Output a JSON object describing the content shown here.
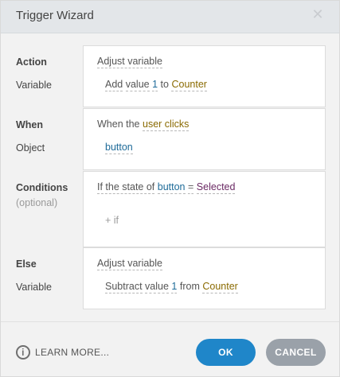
{
  "dialog": {
    "title": "Trigger Wizard",
    "close_icon": "close-icon"
  },
  "sections": {
    "action": {
      "label": "Action",
      "sub_label": "Variable",
      "line1": {
        "text": "Adjust variable"
      },
      "line2": {
        "verb": "Add",
        "value_word": "value",
        "value": "1",
        "prep": "to",
        "target": "Counter"
      }
    },
    "when": {
      "label": "When",
      "sub_label": "Object",
      "line1": {
        "prefix": "When the",
        "event": "user clicks"
      },
      "line2": {
        "object": "button"
      }
    },
    "conditions": {
      "label": "Conditions",
      "sub_label": "(optional)",
      "line1": {
        "prefix": "If the state of",
        "object": "button",
        "operator": "=",
        "state": "Selected"
      },
      "add_if": "+ if"
    },
    "else": {
      "label": "Else",
      "sub_label": "Variable",
      "line1": {
        "text": "Adjust variable"
      },
      "line2": {
        "verb": "Subtract",
        "value_word": "value",
        "value": "1",
        "prep": "from",
        "target": "Counter"
      }
    }
  },
  "footer": {
    "learn_more": "LEARN MORE...",
    "ok": "OK",
    "cancel": "CANCEL",
    "info_icon": "info-icon"
  },
  "colors": {
    "ok_button": "#1f86c9",
    "cancel_button": "#9aa1a9",
    "token_blue": "#1e6b99",
    "token_olive": "#8a6a00",
    "token_purple": "#6b2a64"
  }
}
